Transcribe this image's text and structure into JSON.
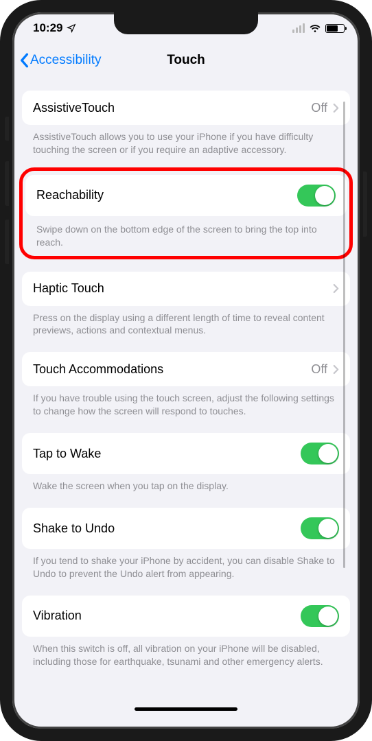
{
  "status": {
    "time": "10:29"
  },
  "nav": {
    "back_label": "Accessibility",
    "title": "Touch"
  },
  "rows": {
    "assistive": {
      "label": "AssistiveTouch",
      "value": "Off",
      "desc": "AssistiveTouch allows you to use your iPhone if you have difficulty touching the screen or if you require an adaptive accessory."
    },
    "reachability": {
      "label": "Reachability",
      "desc": "Swipe down on the bottom edge of the screen to bring the top into reach."
    },
    "haptic": {
      "label": "Haptic Touch",
      "desc": "Press on the display using a different length of time to reveal content previews, actions and contextual menus."
    },
    "accommodations": {
      "label": "Touch Accommodations",
      "value": "Off",
      "desc": "If you have trouble using the touch screen, adjust the following settings to change how the screen will respond to touches."
    },
    "tapwake": {
      "label": "Tap to Wake",
      "desc": "Wake the screen when you tap on the display."
    },
    "shake": {
      "label": "Shake to Undo",
      "desc": "If you tend to shake your iPhone by accident, you can disable Shake to Undo to prevent the Undo alert from appearing."
    },
    "vibration": {
      "label": "Vibration",
      "desc": "When this switch is off, all vibration on your iPhone will be disabled, including those for earthquake, tsunami and other emergency alerts."
    }
  }
}
